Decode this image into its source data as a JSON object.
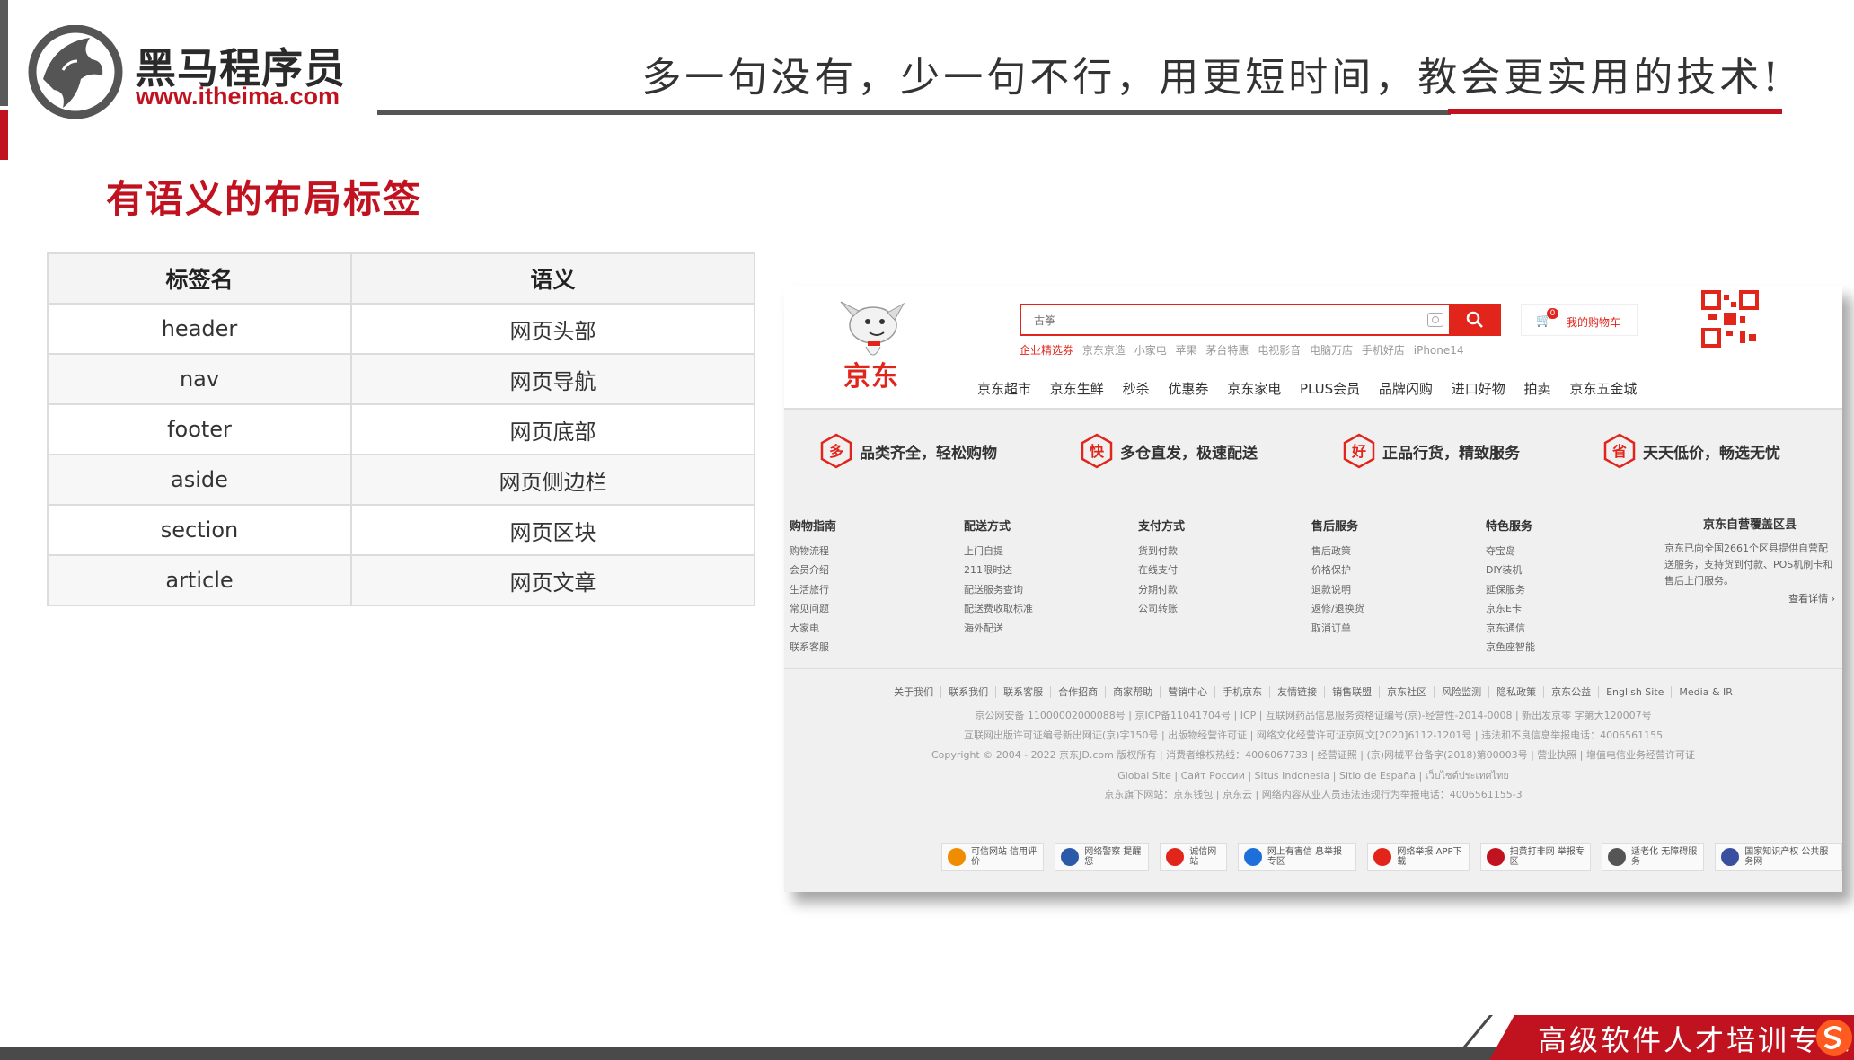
{
  "header": {
    "logo_cn": "黑马程序员",
    "logo_url": "www.itheima.com",
    "slogan": "多一句没有，少一句不行，用更短时间，教会更实用的技术!"
  },
  "title": "有语义的布局标签",
  "table": {
    "headers": [
      "标签名",
      "语义"
    ],
    "rows": [
      [
        "header",
        "网页头部"
      ],
      [
        "nav",
        "网页导航"
      ],
      [
        "footer",
        "网页底部"
      ],
      [
        "aside",
        "网页侧边栏"
      ],
      [
        "section",
        "网页区块"
      ],
      [
        "article",
        "网页文章"
      ]
    ]
  },
  "jd": {
    "logo": "京东",
    "search_value": "古筝",
    "cart_count": "0",
    "cart_label": "我的购物车",
    "hot_words": [
      "企业精选券",
      "京东京造",
      "小家电",
      "苹果",
      "茅台特惠",
      "电视影音",
      "电脑万店",
      "手机好店",
      "iPhone14"
    ],
    "nav": [
      "京东超市",
      "京东生鲜",
      "秒杀",
      "优惠券",
      "京东家电",
      "PLUS会员",
      "品牌闪购",
      "进口好物",
      "拍卖",
      "京东五金城"
    ],
    "promises": [
      {
        "char": "多",
        "label": "品类齐全，轻松购物"
      },
      {
        "char": "快",
        "label": "多仓直发，极速配送"
      },
      {
        "char": "好",
        "label": "正品行货，精致服务"
      },
      {
        "char": "省",
        "label": "天天低价，畅选无忧"
      }
    ],
    "guides": [
      {
        "title": "购物指南",
        "items": [
          "购物流程",
          "会员介绍",
          "生活旅行",
          "常见问题",
          "大家电",
          "联系客服"
        ]
      },
      {
        "title": "配送方式",
        "items": [
          "上门自提",
          "211限时达",
          "配送服务查询",
          "配送费收取标准",
          "海外配送"
        ]
      },
      {
        "title": "支付方式",
        "items": [
          "货到付款",
          "在线支付",
          "分期付款",
          "公司转账"
        ]
      },
      {
        "title": "售后服务",
        "items": [
          "售后政策",
          "价格保护",
          "退款说明",
          "返修/退换货",
          "取消订单"
        ]
      },
      {
        "title": "特色服务",
        "items": [
          "夺宝岛",
          "DIY装机",
          "延保服务",
          "京东E卡",
          "京东通信",
          "京鱼座智能"
        ]
      }
    ],
    "coverage": {
      "title": "京东自营覆盖区县",
      "text": "京东已向全国2661个区县提供自营配送服务，支持货到付款、POS机刷卡和售后上门服务。",
      "more": "查看详情 ›"
    },
    "footer_links": [
      "关于我们",
      "联系我们",
      "联系客服",
      "合作招商",
      "商家帮助",
      "营销中心",
      "手机京东",
      "友情链接",
      "销售联盟",
      "京东社区",
      "风险监测",
      "隐私政策",
      "京东公益",
      "English Site",
      "Media & IR"
    ],
    "info_lines": [
      "京公网安备 11000002000088号  |  京ICP备11041704号  |  ICP  |  互联网药品信息服务资格证编号(京)-经营性-2014-0008  |  新出发京零 字第大120007号",
      "互联网出版许可证编号新出网证(京)字150号  |  出版物经营许可证  |  网络文化经营许可证京网文[2020]6112-1201号  |  违法和不良信息举报电话：4006561155",
      "Copyright © 2004 - 2022  京东JD.com 版权所有  |  消费者维权热线：4006067733  |  经营证照  |  (京)网械平台备字(2018)第00003号  |  营业执照  |  增值电信业务经营许可证",
      "Global Site  |  Сайт России  |  Situs Indonesia  |  Sitio de España  |  เว็บไซต์ประเทศไทย",
      "京东旗下网站：京东钱包  |  京东云  |  网络内容从业人员违法违规行为举报电话：4006561155-3"
    ],
    "badges": [
      {
        "label": "可信网站 信用评价",
        "color": "#f08c00"
      },
      {
        "label": "网络警察 提醒您",
        "color": "#2b5aa8"
      },
      {
        "label": "诚信网站",
        "color": "#e1251b"
      },
      {
        "label": "网上有害信 息举报专区",
        "color": "#1e6fd9"
      },
      {
        "label": "网络举报 APP下载",
        "color": "#e1251b"
      },
      {
        "label": "扫黄打非网 举报专区",
        "color": "#c1121f"
      },
      {
        "label": "适老化 无障碍服务",
        "color": "#555555"
      },
      {
        "label": "国家知识产权 公共服务网",
        "color": "#3a4fa0"
      }
    ]
  },
  "footer": {
    "text": "高级软件人才培训专家"
  },
  "colors": {
    "brand_red": "#c1121f",
    "jd_red": "#e1251b",
    "dark_gray": "#4a4a4a"
  }
}
